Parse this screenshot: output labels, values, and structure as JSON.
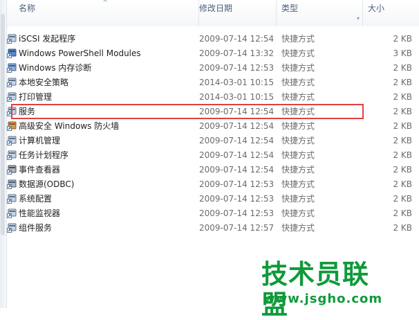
{
  "columns": {
    "name": "名称",
    "date": "修改日期",
    "type": "类型",
    "size": "大小"
  },
  "files": [
    {
      "name": "iSCSI 发起程序",
      "date": "2009-07-14 12:54",
      "type": "快捷方式",
      "size": "2 KB",
      "icon": "iscsi-shortcut-icon"
    },
    {
      "name": "Windows PowerShell Modules",
      "date": "2009-07-14 13:32",
      "type": "快捷方式",
      "size": "3 KB",
      "icon": "powershell-shortcut-icon"
    },
    {
      "name": "Windows 内存诊断",
      "date": "2009-07-14 12:53",
      "type": "快捷方式",
      "size": "2 KB",
      "icon": "memory-diagnostic-shortcut-icon"
    },
    {
      "name": "本地安全策略",
      "date": "2014-03-01 10:15",
      "type": "快捷方式",
      "size": "2 KB",
      "icon": "local-security-policy-shortcut-icon"
    },
    {
      "name": "打印管理",
      "date": "2014-03-01 10:15",
      "type": "快捷方式",
      "size": "2 KB",
      "icon": "print-management-shortcut-icon"
    },
    {
      "name": "服务",
      "date": "2009-07-14 12:54",
      "type": "快捷方式",
      "size": "2 KB",
      "icon": "services-shortcut-icon"
    },
    {
      "name": "高级安全 Windows 防火墙",
      "date": "2009-07-14 12:54",
      "type": "快捷方式",
      "size": "2 KB",
      "icon": "firewall-shortcut-icon"
    },
    {
      "name": "计算机管理",
      "date": "2009-07-14 12:54",
      "type": "快捷方式",
      "size": "2 KB",
      "icon": "computer-management-shortcut-icon"
    },
    {
      "name": "任务计划程序",
      "date": "2009-07-14 12:54",
      "type": "快捷方式",
      "size": "2 KB",
      "icon": "task-scheduler-shortcut-icon"
    },
    {
      "name": "事件查看器",
      "date": "2009-07-14 12:54",
      "type": "快捷方式",
      "size": "2 KB",
      "icon": "event-viewer-shortcut-icon"
    },
    {
      "name": "数据源(ODBC)",
      "date": "2009-07-14 12:53",
      "type": "快捷方式",
      "size": "2 KB",
      "icon": "odbc-shortcut-icon"
    },
    {
      "name": "系统配置",
      "date": "2009-07-14 12:53",
      "type": "快捷方式",
      "size": "2 KB",
      "icon": "system-configuration-shortcut-icon"
    },
    {
      "name": "性能监视器",
      "date": "2009-07-14 12:53",
      "type": "快捷方式",
      "size": "2 KB",
      "icon": "performance-monitor-shortcut-icon"
    },
    {
      "name": "组件服务",
      "date": "2009-07-14 12:57",
      "type": "快捷方式",
      "size": "2 KB",
      "icon": "component-services-shortcut-icon"
    }
  ],
  "watermark": {
    "title": "技术员联盟",
    "url": "www.jsgho.com"
  },
  "colors": {
    "highlight_border": "#e04040",
    "watermark": "#0f9a3a",
    "header_text": "#4c607a"
  }
}
